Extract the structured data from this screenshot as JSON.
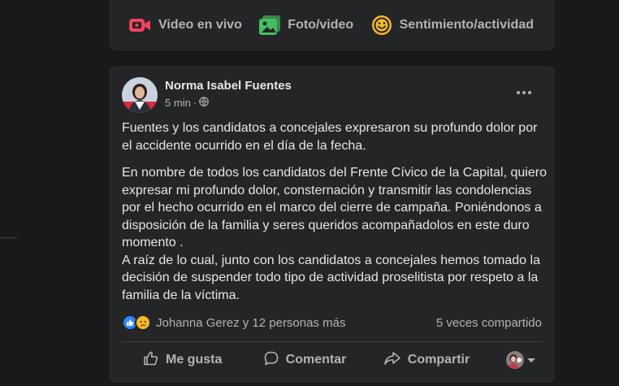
{
  "composer": {
    "live_label": "Video en vivo",
    "photo_label": "Foto/video",
    "feeling_label": "Sentimiento/actividad",
    "colors": {
      "live": "#f3425f",
      "photo": "#45bd62",
      "feeling": "#f7b928"
    }
  },
  "post": {
    "author": "Norma Isabel Fuentes",
    "time": "5 min",
    "dot": "·",
    "paragraph1": "Fuentes y los candidatos a concejales expresaron su profundo dolor por el accidente ocurrido  en el día de la fecha.",
    "paragraph2": "En nombre de todos los candidatos del Frente Cívico de la Capital, quiero expresar mi profundo dolor, consternación y transmitir las condolencias por el hecho ocurrido en el marco del cierre de campaña. Poniéndonos a disposición  de la familia y seres queridos acompañadolos en este duro momento .",
    "paragraph3": "A raíz de lo cual, junto con los candidatos a concejales hemos tomado la decisión de suspender todo tipo de actividad proselitista por respeto a la familia de la víctima.",
    "reactions_text": "Johanna Gerez y 12 personas más",
    "shares_text": "5 veces compartido"
  },
  "actions": {
    "like": "Me gusta",
    "comment": "Comentar",
    "share": "Compartir"
  }
}
